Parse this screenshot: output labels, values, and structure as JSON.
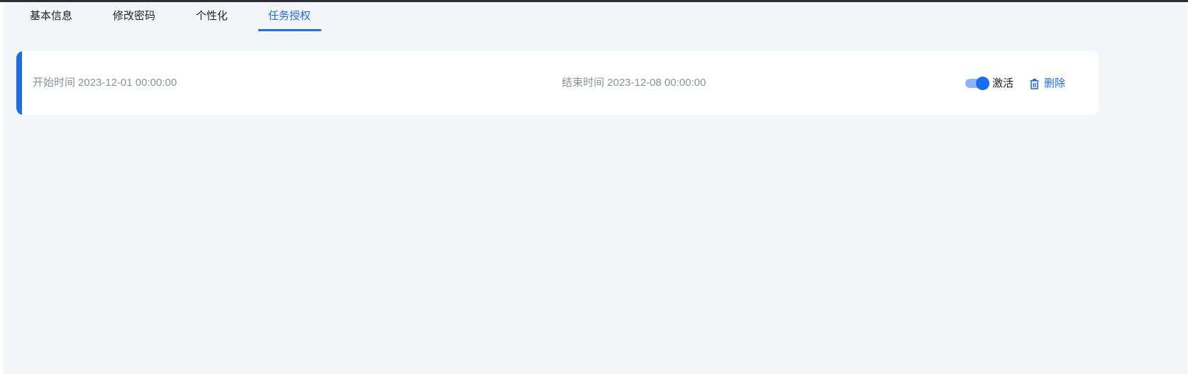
{
  "tabs": [
    {
      "label": "基本信息"
    },
    {
      "label": "修改密码"
    },
    {
      "label": "个性化"
    },
    {
      "label": "任务授权",
      "active": true
    }
  ],
  "task": {
    "start_label": "开始时间",
    "start_value": "2023-12-01 00:00:00",
    "end_label": "结束时间",
    "end_value": "2023-12-08 00:00:00",
    "active_label": "激活",
    "active_on": true,
    "delete_label": "删除",
    "delete_icon": "trash-icon"
  },
  "colors": {
    "accent": "#1a6df0",
    "background": "#f4f5f9",
    "card": "#ffffff",
    "muted_text": "#8a8f99"
  }
}
